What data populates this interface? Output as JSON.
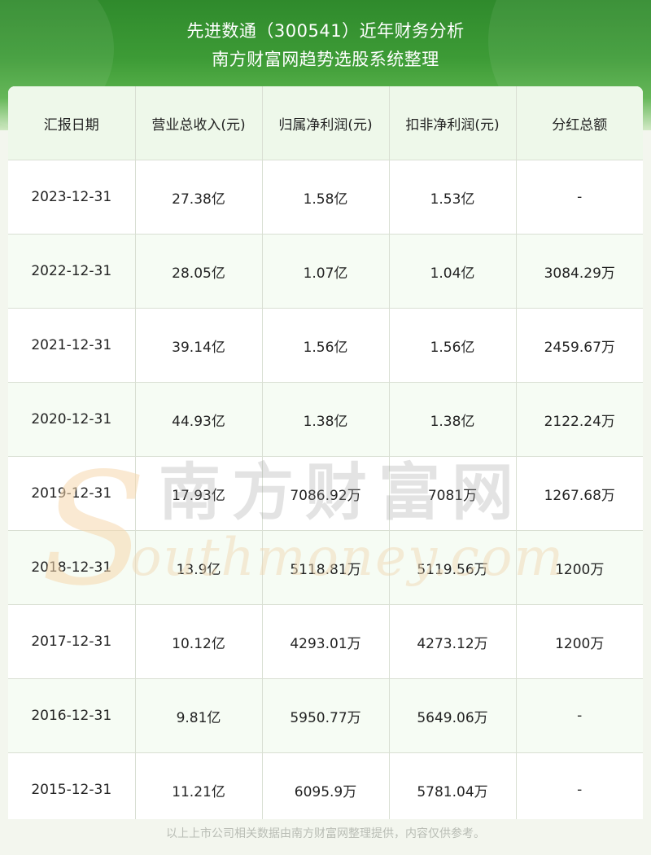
{
  "header": {
    "title_line1": "先进数通（300541）近年财务分析",
    "title_line2": "南方财富网趋势选股系统整理"
  },
  "table": {
    "columns": [
      "汇报日期",
      "营业总收入(元)",
      "归属净利润(元)",
      "扣非净利润(元)",
      "分红总额"
    ],
    "rows": [
      [
        "2023-12-31",
        "27.38亿",
        "1.58亿",
        "1.53亿",
        "-"
      ],
      [
        "2022-12-31",
        "28.05亿",
        "1.07亿",
        "1.04亿",
        "3084.29万"
      ],
      [
        "2021-12-31",
        "39.14亿",
        "1.56亿",
        "1.56亿",
        "2459.67万"
      ],
      [
        "2020-12-31",
        "44.93亿",
        "1.38亿",
        "1.38亿",
        "2122.24万"
      ],
      [
        "2019-12-31",
        "17.93亿",
        "7086.92万",
        "7081万",
        "1267.68万"
      ],
      [
        "2018-12-31",
        "13.9亿",
        "5118.81万",
        "5119.56万",
        "1200万"
      ],
      [
        "2017-12-31",
        "10.12亿",
        "4293.01万",
        "4273.12万",
        "1200万"
      ],
      [
        "2016-12-31",
        "9.81亿",
        "5950.77万",
        "5649.06万",
        "-"
      ],
      [
        "2015-12-31",
        "11.21亿",
        "6095.9万",
        "5781.04万",
        "-"
      ]
    ]
  },
  "watermark": {
    "cn": "南方财富网",
    "en": "outhmoney.com",
    "letter": "S"
  },
  "footer": {
    "note": "以上上市公司相关数据由南方财富网整理提供，内容仅供参考。"
  },
  "colors": {
    "banner_green": "#3d9b36",
    "header_row_bg": "#eef8ea",
    "zebra_bg": "#f0faec"
  }
}
